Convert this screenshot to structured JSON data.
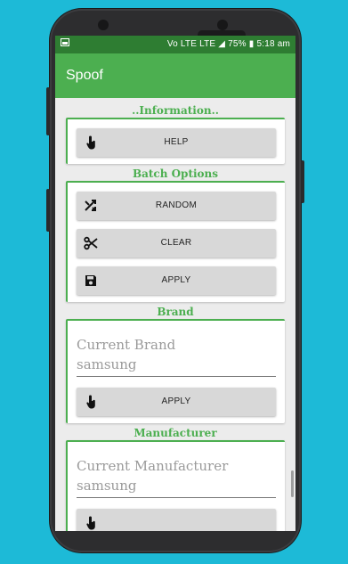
{
  "status_bar": {
    "left_icon": "image-notification-icon",
    "indicators": "Vo LTE  LTE",
    "battery": "75%",
    "time": "5:18 am"
  },
  "app_bar": {
    "title": "Spoof"
  },
  "sections": {
    "information": {
      "title": "..Information..",
      "help_label": "HELP"
    },
    "batch": {
      "title": "Batch Options",
      "random_label": "RANDOM",
      "clear_label": "CLEAR",
      "apply_label": "APPLY"
    },
    "brand": {
      "title": "Brand",
      "current_label": "Current Brand",
      "current_value": "samsung",
      "apply_label": "APPLY"
    },
    "manufacturer": {
      "title": "Manufacturer",
      "current_label": "Current Manufacturer",
      "current_value": "samsung"
    }
  },
  "colors": {
    "accent": "#4caf50",
    "status_bar": "#2e7d32",
    "background": "#1dbad7",
    "button": "#d8d8d8"
  },
  "icons": [
    "tap-icon",
    "shuffle-icon",
    "scissors-icon",
    "save-icon"
  ]
}
